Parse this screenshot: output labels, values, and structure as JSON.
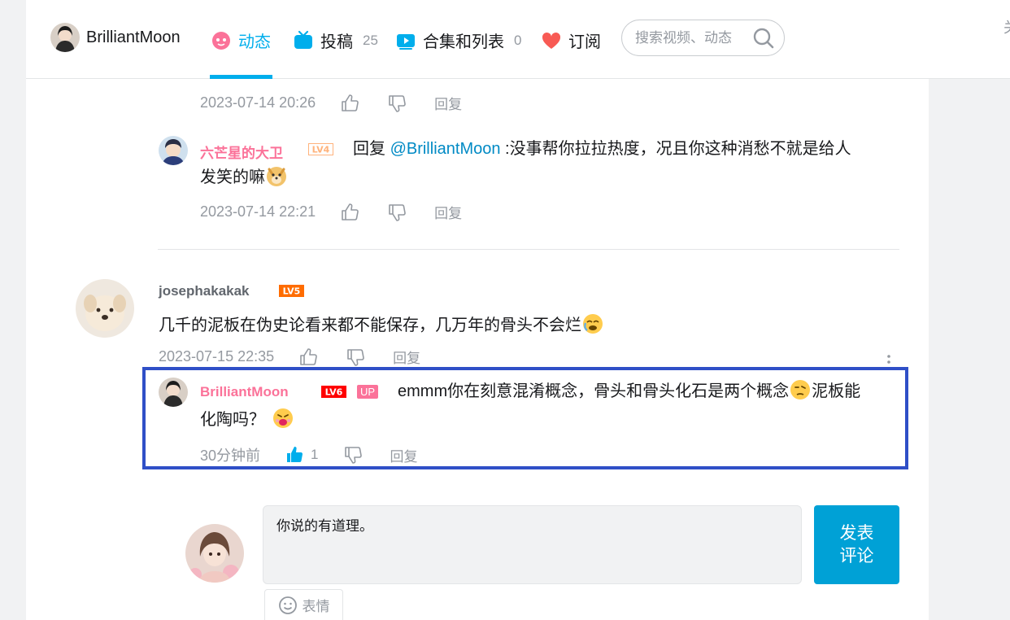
{
  "header": {
    "username": "BrilliantMoon",
    "nav": [
      {
        "label": "动态",
        "count": "",
        "icon": "dynamic-icon"
      },
      {
        "label": "投稿",
        "count": "25",
        "icon": "tv-icon"
      },
      {
        "label": "合集和列表",
        "count": "0",
        "icon": "play-list-icon"
      },
      {
        "label": "订阅",
        "count": "",
        "icon": "heart-icon"
      }
    ],
    "search_placeholder": "搜索视频、动态",
    "edge_text": "关"
  },
  "comments": {
    "reply_a": {
      "time": "2023-07-14 20:26",
      "reply_label": "回复"
    },
    "reply_b": {
      "author": "六芒星的大卫",
      "level": "LV4",
      "text_prefix": "回复 ",
      "mention": "@BrilliantMoon",
      "text_line1": " :没事帮你拉拉热度，况且你这种消愁不就是给人",
      "text_line2": "发笑的嘛",
      "time": "2023-07-14 22:21",
      "reply_label": "回复"
    },
    "root": {
      "author": "josephakakak",
      "level": "LV5",
      "text": "几千的泥板在伪史论看来都不能保存，几万年的骨头不会烂",
      "time": "2023-07-15 22:35",
      "reply_label": "回复"
    },
    "highlighted_reply": {
      "author": "BrilliantMoon",
      "level": "LV6",
      "up_badge": "UP",
      "text_line1": "emmm你在刻意混淆概念，骨头和骨头化石是两个概念",
      "text_line1b": "泥板能",
      "text_line2": "化陶吗？",
      "time": "30分钟前",
      "likes": "1",
      "reply_label": "回复"
    }
  },
  "composer": {
    "value": "你说的有道理。",
    "submit_label": "发表\n评论",
    "emoji_label": "表情"
  },
  "colors": {
    "accent": "#00aeec",
    "pink_name": "#fb7299",
    "highlight_border": "#2f4fc7"
  }
}
